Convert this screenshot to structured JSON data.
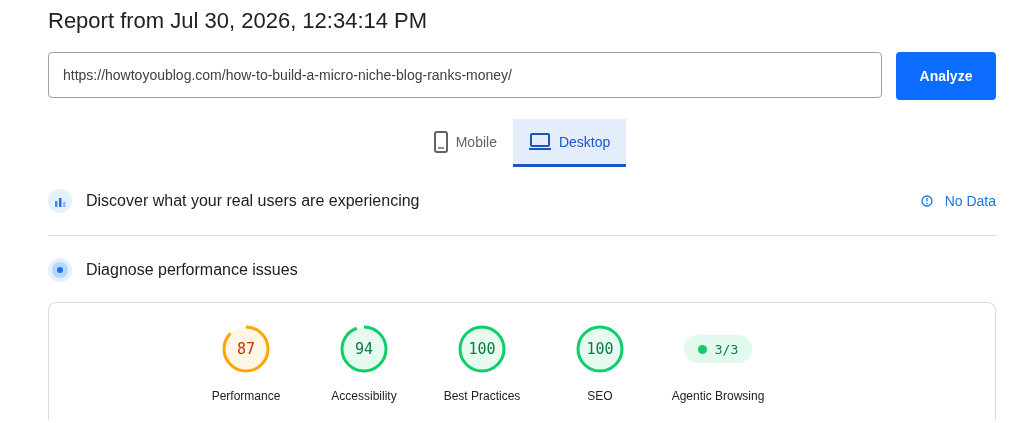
{
  "title": "Report from Jul 30, 2026, 12:34:14 PM",
  "url_field": {
    "value": "https://howtoyoublog.com/how-to-build-a-micro-niche-blog-ranks-money/"
  },
  "analyze_button": "Analyze",
  "tabs": [
    {
      "label": "Mobile",
      "kind": "mobile",
      "selected": false
    },
    {
      "label": "Desktop",
      "kind": "desktop",
      "selected": true
    }
  ],
  "field_data": {
    "heading": "Discover what your real users are experiencing",
    "status": "No Data"
  },
  "diagnose": {
    "heading": "Diagnose performance issues"
  },
  "scores": [
    {
      "kind": "gauge",
      "value": "87",
      "label": "Performance",
      "color": "#ffa400"
    },
    {
      "kind": "gauge",
      "value": "94",
      "label": "Accessibility",
      "color": "#0cce6b"
    },
    {
      "kind": "gauge",
      "value": "100",
      "label": "Best Practices",
      "color": "#0cce6b"
    },
    {
      "kind": "gauge",
      "value": "100",
      "label": "SEO",
      "color": "#0cce6b"
    },
    {
      "kind": "badge",
      "value": "3/3",
      "label": "Agentic Browsing",
      "color": "#0cce6b"
    }
  ]
}
